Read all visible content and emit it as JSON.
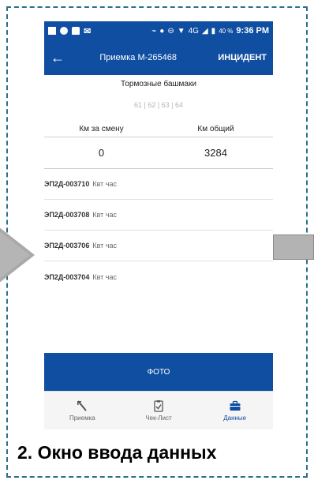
{
  "statusbar": {
    "signal_text": "4G",
    "battery_percent": "40 %",
    "time": "9:36 PM"
  },
  "appbar": {
    "back_icon": "arrow-left-icon",
    "title": "Приемка М-265468",
    "incident_label": "ИНЦИДЕНТ"
  },
  "section_title": "Тормозные башмаки",
  "codes": "61 | 62 | 63 | 64",
  "km": {
    "shift_label": "Км за смену",
    "total_label": "Км общий",
    "shift_value": "0",
    "total_value": "3284"
  },
  "readings": [
    {
      "code": "ЭП2Д-003710",
      "unit": "Квт час"
    },
    {
      "code": "ЭП2Д-003708",
      "unit": "Квт час"
    },
    {
      "code": "ЭП2Д-003706",
      "unit": "Квт час"
    },
    {
      "code": "ЭП2Д-003704",
      "unit": "Квт час"
    }
  ],
  "photo_button": "ФОТО",
  "nav": {
    "items": [
      {
        "label": "Приемка",
        "icon": "priemka-icon"
      },
      {
        "label": "Чек-Лист",
        "icon": "checklist-icon"
      },
      {
        "label": "Данные",
        "icon": "briefcase-icon"
      }
    ],
    "active_index": 2
  },
  "caption": "2. Окно ввода данных",
  "colors": {
    "brand": "#0f4ea1",
    "frame": "#2e6f8e"
  }
}
